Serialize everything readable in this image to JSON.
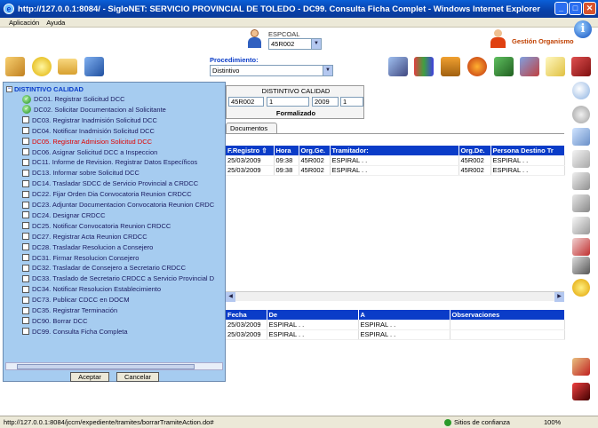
{
  "window": {
    "title": "http://127.0.0.1:8084/ - SigloNET: SERVICIO PROVINCIAL DE TOLEDO - DC99. Consulta Ficha Complet - Windows Internet Explorer"
  },
  "menu": {
    "items": [
      "Aplicación",
      "Ayuda"
    ]
  },
  "header": {
    "espcoal_label": "ESPCOAL",
    "espcoal_value": "45R002",
    "gestion_label": "Gestión Organismo",
    "procedimiento_label": "Procedimiento:",
    "procedimiento_value": "Distintivo"
  },
  "expediente": {
    "title": "DISTINTIVO CALIDAD",
    "fields": [
      "45R002",
      "1",
      "2009",
      "1"
    ],
    "status": "Formalizado"
  },
  "tabs": {
    "documentos": "Documentos"
  },
  "tramites_table": {
    "headers": [
      "F.Registro",
      "Hora",
      "Org.Ge.",
      "Tramitador:",
      "Org.De.",
      "Persona Destino Tr"
    ],
    "rows": [
      [
        "25/03/2009",
        "09:38",
        "45R002",
        "ESPIRAL . .",
        "45R002",
        "ESPIRAL . ."
      ],
      [
        "25/03/2009",
        "09:38",
        "45R002",
        "ESPIRAL . .",
        "45R002",
        "ESPIRAL . ."
      ]
    ]
  },
  "movimientos_table": {
    "headers": [
      "Fecha",
      "De",
      "A",
      "Observaciones"
    ],
    "rows": [
      [
        "25/03/2009",
        "ESPIRAL . .",
        "ESPIRAL . .",
        ""
      ],
      [
        "25/03/2009",
        "ESPIRAL . .",
        "ESPIRAL . .",
        ""
      ]
    ]
  },
  "tree": {
    "root": "DISTINTIVO CALIDAD",
    "items": [
      {
        "label": "DC01. Registrar Solicitud DCC",
        "done": true
      },
      {
        "label": "DC02. Solicitar Documentacion al Solicitante",
        "done": true
      },
      {
        "label": "DC03. Registrar Inadmisión Solicitud DCC"
      },
      {
        "label": "DC04. Notificar Inadmisión Solicitud DCC"
      },
      {
        "label": "DC05. Registrar Admision Solicitud DCC",
        "active": true
      },
      {
        "label": "DC06. Asignar Solicitud DCC a Inspeccion"
      },
      {
        "label": "DC11. Informe de Revision. Registrar Datos Específicos"
      },
      {
        "label": "DC13. Informar sobre Solicitud DCC"
      },
      {
        "label": "DC14. Trasladar SDCC de Servicio Provincial a CRDCC"
      },
      {
        "label": "DC22. Fijar Orden Dia Convocatoria Reunion CRDCC"
      },
      {
        "label": "DC23. Adjuntar Documentacion Convocatoria Reunion CRDC"
      },
      {
        "label": "DC24. Designar CRDCC"
      },
      {
        "label": "DC25. Notificar Convocatoria Reunion CRDCC"
      },
      {
        "label": "DC27. Registrar Acta Reunion CRDCC"
      },
      {
        "label": "DC28. Trasladar Resolucion a Consejero"
      },
      {
        "label": "DC31. Firmar Resolucion Consejero"
      },
      {
        "label": "DC32. Trasladar de Consejero a Secretario CRDCC"
      },
      {
        "label": "DC33. Traslado de Secretario CRDCC a Servicio Provincial D"
      },
      {
        "label": "DC34. Notificar Resolucion Establecimiento"
      },
      {
        "label": "DC73. Publicar CDCC en DOCM"
      },
      {
        "label": "DC35. Registrar Terminación"
      },
      {
        "label": "DC90. Borrar DCC"
      },
      {
        "label": "DC99. Consulta Ficha Completa"
      }
    ],
    "accept_label": "Aceptar",
    "cancel_label": "Cancelar"
  },
  "status": {
    "url": "http://127.0.0.1:8084/jccm/expediente/tramites/borrarTramiteAction.do#",
    "zone": "Sitios de confianza",
    "zoom": "100%"
  }
}
